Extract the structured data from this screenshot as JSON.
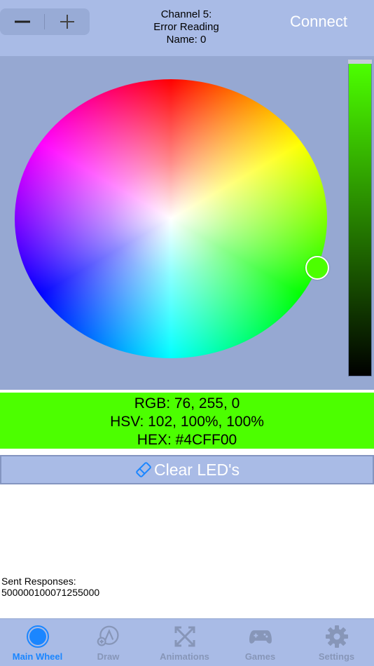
{
  "header": {
    "stepper": {
      "minus_label": "−",
      "plus_label": "+"
    },
    "channel_line1": "Channel 5:",
    "channel_line2": "Error Reading",
    "channel_line3": "Name: 0",
    "connect_label": "Connect"
  },
  "color_picker": {
    "selected_color": "#4cff00"
  },
  "info": {
    "rgb": "RGB: 76, 255, 0",
    "hsv": "HSV: 102, 100%, 100%",
    "hex": "HEX: #4CFF00"
  },
  "clear_button": {
    "label": "Clear LED's"
  },
  "responses": {
    "title": "Sent Responses:",
    "value": "500000100071255000"
  },
  "tabbar": {
    "items": [
      {
        "label": "Main Wheel",
        "icon": "circle-icon",
        "active": true
      },
      {
        "label": "Draw",
        "icon": "draw-icon",
        "active": false
      },
      {
        "label": "Animations",
        "icon": "animations-icon",
        "active": false
      },
      {
        "label": "Games",
        "icon": "gamepad-icon",
        "active": false
      },
      {
        "label": "Settings",
        "icon": "gear-icon",
        "active": false
      }
    ]
  },
  "colors": {
    "header_bg": "#a9bbe6",
    "picker_bg": "#96a8d2",
    "accent_blue": "#1b86ff",
    "tab_inactive": "#8796b8"
  }
}
